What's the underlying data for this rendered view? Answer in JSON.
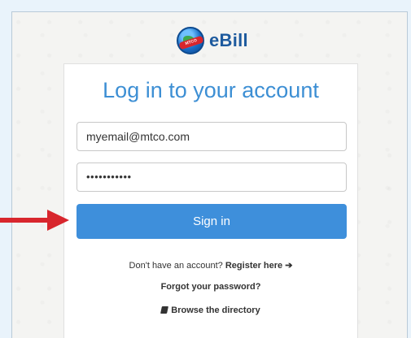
{
  "brand": {
    "name": "eBill",
    "emblem_text": "MTCO"
  },
  "login": {
    "title": "Log in to your account",
    "email_value": "myemail@mtco.com",
    "password_value": "•••••••••••",
    "signin_label": "Sign in",
    "register_prompt": "Don't have an account?",
    "register_link": "Register here",
    "register_arrow": "➔",
    "forgot_label": "Forgot your password?",
    "browse_label": "Browse the directory"
  },
  "colors": {
    "accent": "#3e8fdb",
    "title": "#3d8fd4",
    "arrow": "#d8262d"
  }
}
